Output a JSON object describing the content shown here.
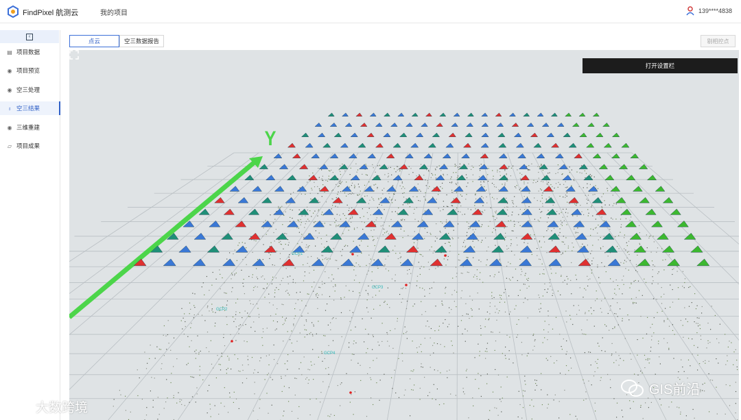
{
  "header": {
    "app_name": "FindPixel 航测云",
    "nav_item": "我的项目",
    "user_phone": "139****4838"
  },
  "sidebar": {
    "items": [
      {
        "label": "项目数据",
        "icon": "document-icon"
      },
      {
        "label": "项目预览",
        "icon": "eye-icon"
      },
      {
        "label": "空三处理",
        "icon": "eye-icon"
      },
      {
        "label": "空三结果",
        "icon": "bulb-icon"
      },
      {
        "label": "三维重建",
        "icon": "eye-icon"
      },
      {
        "label": "项目成果",
        "icon": "layers-icon"
      }
    ],
    "active_index": 3
  },
  "tabs": [
    {
      "label": "点云",
      "active": true
    },
    {
      "label": "空三数据报告",
      "active": false
    }
  ],
  "toolbar": {
    "delete_label": "剔相控点"
  },
  "viewer": {
    "settings_button": "打开设置栏",
    "axis_label": "Y",
    "gcp_labels": [
      "GCP1",
      "GCP2",
      "GCP3",
      "GCP4"
    ]
  },
  "watermarks": {
    "left": "大数跨境",
    "right": "GIS前沿"
  },
  "colors": {
    "accent": "#2f5fc6",
    "axis_green": "#4cd54a",
    "camera_blue": "#3a78d6",
    "camera_red": "#e03030",
    "camera_teal": "#1f8f78",
    "camera_green": "#3cb830"
  }
}
